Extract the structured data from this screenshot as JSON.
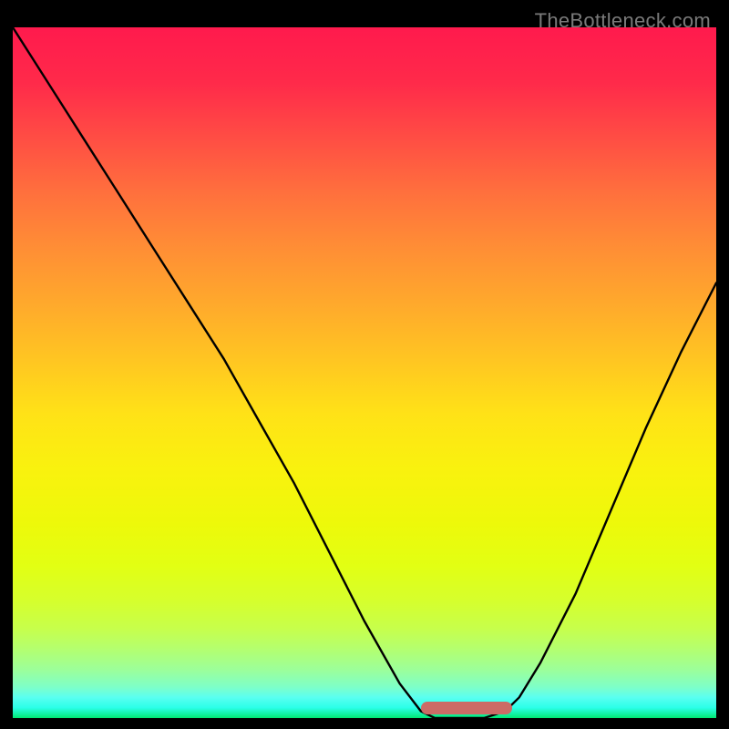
{
  "watermark": "TheBottleneck.com",
  "colors": {
    "curve_stroke": "#000000",
    "marker_fill": "#cc6b66",
    "frame_bg": "#000000"
  },
  "chart_data": {
    "type": "line",
    "title": "",
    "xlabel": "",
    "ylabel": "",
    "xlim": [
      0,
      100
    ],
    "ylim": [
      0,
      100
    ],
    "grid": false,
    "legend": false,
    "series": [
      {
        "name": "bottleneck-curve",
        "x": [
          0,
          5,
          10,
          15,
          20,
          25,
          30,
          35,
          40,
          45,
          50,
          55,
          58,
          60,
          63,
          67,
          70,
          72,
          75,
          80,
          85,
          90,
          95,
          100
        ],
        "values": [
          100,
          92,
          84,
          76,
          68,
          60,
          52,
          43,
          34,
          24,
          14,
          5,
          1,
          0,
          0,
          0,
          1,
          3,
          8,
          18,
          30,
          42,
          53,
          63
        ]
      }
    ],
    "annotations": [
      {
        "name": "optimal-range-marker",
        "x_start": 58,
        "x_end": 71,
        "y": 0
      }
    ]
  }
}
